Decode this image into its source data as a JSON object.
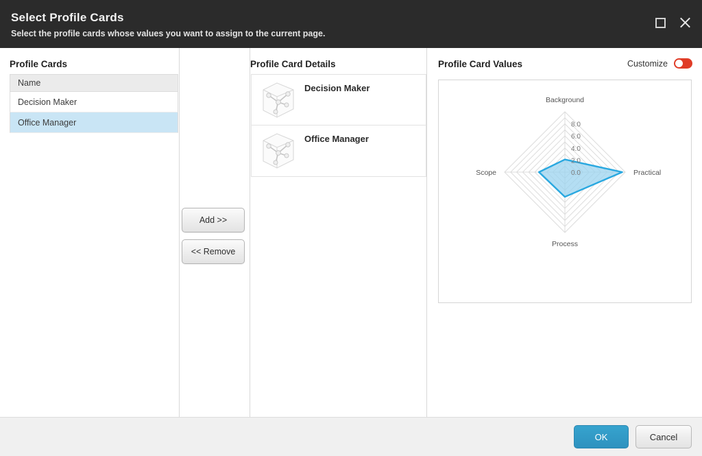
{
  "window": {
    "title": "Select Profile Cards",
    "subtitle": "Select the profile cards whose values you want to assign to the current page.",
    "maximize_icon": "maximize-icon",
    "close_icon": "close-icon"
  },
  "panels": {
    "profile_cards_title": "Profile Cards",
    "details_title": "Profile Card Details",
    "values_title": "Profile Card Values"
  },
  "list": {
    "column_header": "Name",
    "rows": [
      {
        "name": "Decision Maker",
        "selected": false
      },
      {
        "name": "Office Manager",
        "selected": true
      }
    ]
  },
  "transfer": {
    "add_label": "Add >>",
    "remove_label": "<< Remove"
  },
  "details": {
    "cards": [
      {
        "name": "Decision Maker",
        "thumbnail": "profile-card-thumbnail-icon"
      },
      {
        "name": "Office Manager",
        "thumbnail": "profile-card-thumbnail-icon"
      }
    ]
  },
  "customize": {
    "label": "Customize",
    "state": "off",
    "color": "#e03c27"
  },
  "footer": {
    "ok_label": "OK",
    "cancel_label": "Cancel",
    "ok_color": "#2e92bf"
  },
  "chart_data": {
    "type": "radar",
    "title": "Profile Card Values",
    "categories": [
      "Background",
      "Practical",
      "Process",
      "Scope"
    ],
    "values": [
      2.1,
      9.5,
      4.1,
      4.3
    ],
    "series": [
      {
        "name": "Office Manager",
        "values": [
          2.1,
          9.5,
          4.1,
          4.3
        ]
      }
    ],
    "tick_labels": [
      "0.0",
      "2.0",
      "4.0",
      "6.0",
      "8.0"
    ],
    "tick_values": [
      0,
      2,
      4,
      6,
      8
    ],
    "rlim": [
      0,
      10
    ],
    "rings": 10,
    "grid": true,
    "legend": "none",
    "fill_color": "#9bd3ef",
    "line_color": "#29a8e0",
    "grid_color": "#dcdcdc",
    "label_color": "#555555"
  }
}
